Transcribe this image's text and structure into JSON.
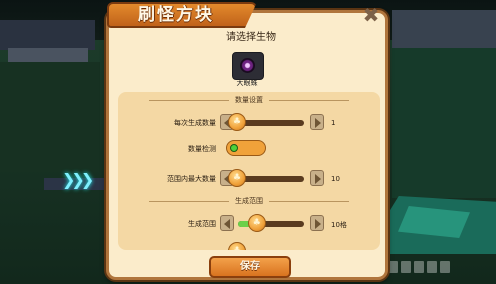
{
  "dialog": {
    "title": "刷怪方块",
    "close_icon": "close-x-icon",
    "heading": "请选择生物",
    "creature": {
      "name": "大眼蛛",
      "icon": "one-eyed-creature-icon"
    }
  },
  "sections": {
    "quantity": {
      "title": "数量设置",
      "rows": [
        {
          "label": "每次生成数量",
          "value": "1",
          "level": 0
        },
        {
          "label": "数量检测"
        },
        {
          "label": "范围内最大数量",
          "value": "10",
          "level": 0
        }
      ]
    },
    "range": {
      "title": "生成范围",
      "rows": [
        {
          "label": "生成范围",
          "value": "10格",
          "level": 0.3
        }
      ]
    }
  },
  "save_label": "保存",
  "colors": {
    "accent": "#e38a2c",
    "panel": "#fbeccb",
    "slider_fill": "#6bd04a"
  }
}
